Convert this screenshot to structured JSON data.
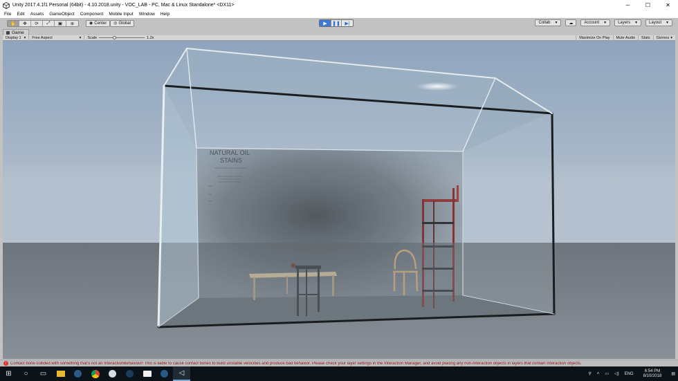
{
  "window": {
    "title": "Unity 2017.4.1f1 Personal (64bit) - 4.10.2018.unity - VOC_LAB - PC, Mac & Linux Standalone* <DX11>",
    "controls": [
      "─",
      "☐",
      "✕"
    ]
  },
  "menu": [
    "File",
    "Edit",
    "Assets",
    "GameObject",
    "Component",
    "Mobile Input",
    "Window",
    "Help"
  ],
  "toolbar": {
    "transform_tools": [
      "✋",
      "✥",
      "⟳",
      "⤢",
      "▣",
      "⊕"
    ],
    "pivot_label": "Center",
    "space_label": "Global",
    "collab_label": "Collab",
    "account_label": "Account",
    "layers_label": "Layers",
    "layout_label": "Layout"
  },
  "game_view": {
    "tab_label": "Game",
    "display_label": "Display 1",
    "aspect_label": "Free Aspect",
    "scale_label": "Scale",
    "scale_value": "1.2x",
    "maximize_label": "Maximize On Play",
    "mute_label": "Mute Audio",
    "stats_label": "Stats",
    "gizmos_label": "Gizmos"
  },
  "scene": {
    "poster_title_line1": "NATURAL OIL",
    "poster_title_line2": "STAINS"
  },
  "console": {
    "message": "Contact bone collided with something that's not an InteractionBehaviour! This is liable to cause contact bones to build unstable velocities and produce bad behavior. Please check your layer settings in the Interaction Manager, and avoid placing any non-Interaction objects in layers that contain Interaction objects."
  },
  "taskbar": {
    "icons": [
      "start-icon",
      "search-icon",
      "task-view-icon",
      "file-explorer-icon",
      "steam-icon",
      "chrome-icon",
      "app-icon",
      "steam-icon",
      "app-icon",
      "steam-icon",
      "unity-icon"
    ],
    "language": "ENG",
    "time": "6:54 PM",
    "date": "8/10/2018"
  },
  "colors": {
    "play_accent": "#3d7ad6",
    "editor_gray": "#c2c2c2",
    "taskbar": "#0b1218",
    "error": "#8a1a1a"
  }
}
